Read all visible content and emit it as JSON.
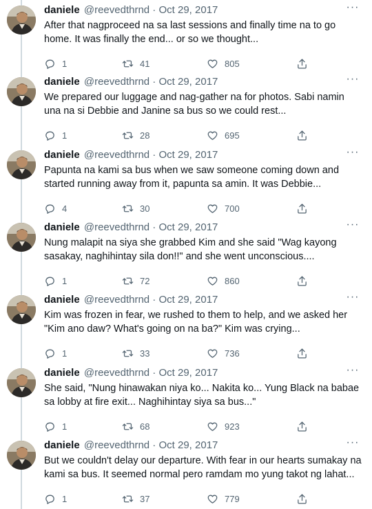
{
  "tweets": [
    {
      "name": "daniele",
      "handle": "@reevedthrnd",
      "date": "Oct 29, 2017",
      "text": "After that nagproceed na sa last sessions and finally time na to go home. It was finally the end... or so we thought...",
      "replies": "1",
      "retweets": "41",
      "likes": "805"
    },
    {
      "name": "daniele",
      "handle": "@reevedthrnd",
      "date": "Oct 29, 2017",
      "text": "We prepared our luggage and nag-gather na for photos. Sabi namin una na si Debbie and Janine sa bus so we could rest...",
      "replies": "1",
      "retweets": "28",
      "likes": "695"
    },
    {
      "name": "daniele",
      "handle": "@reevedthrnd",
      "date": "Oct 29, 2017",
      "text": "Papunta na kami sa bus when we saw someone coming down and started running away from it, papunta sa amin. It was Debbie...",
      "replies": "4",
      "retweets": "30",
      "likes": "700"
    },
    {
      "name": "daniele",
      "handle": "@reevedthrnd",
      "date": "Oct 29, 2017",
      "text": "Nung malapit na siya she grabbed Kim and she said \"Wag kayong sasakay, naghihintay sila don!!\" and she went unconscious....",
      "replies": "1",
      "retweets": "72",
      "likes": "860"
    },
    {
      "name": "daniele",
      "handle": "@reevedthrnd",
      "date": "Oct 29, 2017",
      "text": "Kim was frozen in fear, we rushed to them to help, and we asked her \"Kim ano daw? What's going on na ba?\" Kim was crying...",
      "replies": "1",
      "retweets": "33",
      "likes": "736"
    },
    {
      "name": "daniele",
      "handle": "@reevedthrnd",
      "date": "Oct 29, 2017",
      "text": "She said, \"Nung hinawakan niya ko... Nakita ko... Yung Black na babae sa lobby at fire exit... Naghihintay siya sa bus...\"",
      "replies": "1",
      "retweets": "68",
      "likes": "923"
    },
    {
      "name": "daniele",
      "handle": "@reevedthrnd",
      "date": "Oct 29, 2017",
      "text": "But we couldn't delay our departure. With fear in our hearts sumakay na kami sa bus. It seemed normal pero ramdam mo yung takot ng lahat...",
      "replies": "1",
      "retweets": "37",
      "likes": "779"
    }
  ],
  "separator": " · ",
  "more_glyph": "···",
  "icons": {
    "reply": "reply-icon",
    "retweet": "retweet-icon",
    "like": "heart-icon",
    "share": "share-icon"
  },
  "colors": {
    "text": "#0f1419",
    "secondary": "#536471",
    "thread_line": "#cfd9de"
  }
}
